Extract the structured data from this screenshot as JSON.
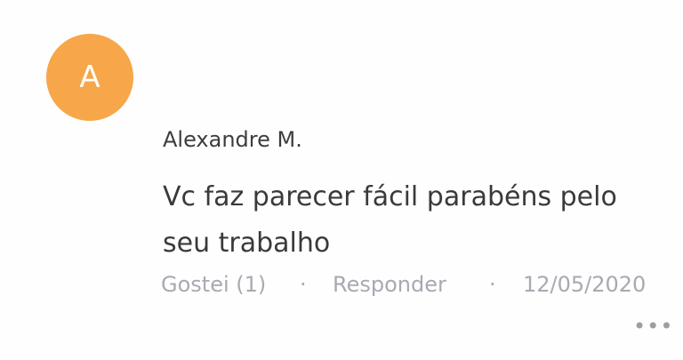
{
  "comment": {
    "avatar_initial": "A",
    "avatar_color": "#f7a64a",
    "author": "Alexandre M.",
    "text": "Vc faz parecer fácil parabéns pelo seu trabalho",
    "like_label": "Gostei (1)",
    "separator": "·",
    "reply_label": "Responder",
    "date": "12/05/2020",
    "more_glyph": "•••"
  }
}
